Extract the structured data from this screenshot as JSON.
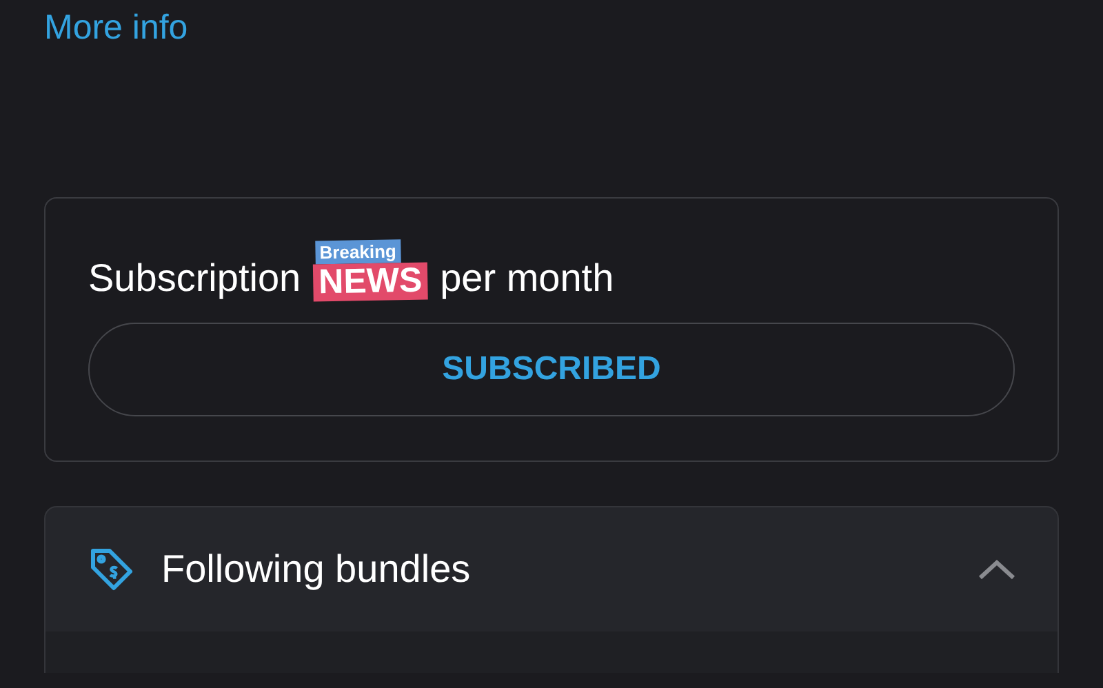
{
  "more_info_link": "More info",
  "subscription": {
    "label_before": "Subscription",
    "sticker": {
      "top": "Breaking",
      "main": "NEWS"
    },
    "label_after": "per month",
    "button": "SUBSCRIBED"
  },
  "bundles": {
    "title": "Following bundles",
    "expanded": true
  }
}
